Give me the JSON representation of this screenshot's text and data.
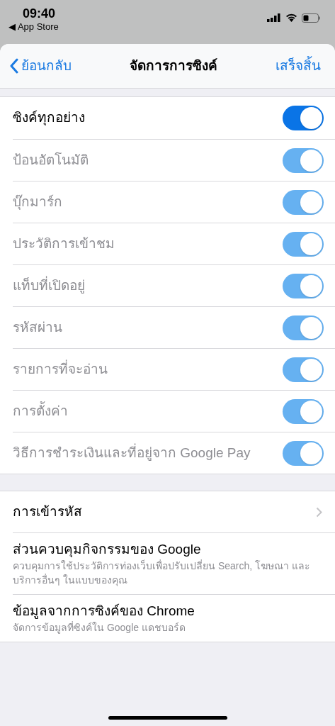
{
  "status_bar": {
    "time": "09:40",
    "back_app": "◀ App Store"
  },
  "nav": {
    "back": "ย้อนกลับ",
    "title": "จัดการการซิงค์",
    "done": "เสร็จสิ้น"
  },
  "sync_items": [
    {
      "label": "ซิงค์ทุกอย่าง",
      "on": true,
      "disabled": false
    },
    {
      "label": "ป้อนอัตโนมัติ",
      "on": true,
      "disabled": true
    },
    {
      "label": "บุ๊กมาร์ก",
      "on": true,
      "disabled": true
    },
    {
      "label": "ประวัติการเข้าชม",
      "on": true,
      "disabled": true
    },
    {
      "label": "แท็บที่เปิดอยู่",
      "on": true,
      "disabled": true
    },
    {
      "label": "รหัสผ่าน",
      "on": true,
      "disabled": true
    },
    {
      "label": "รายการที่จะอ่าน",
      "on": true,
      "disabled": true
    },
    {
      "label": "การตั้งค่า",
      "on": true,
      "disabled": true
    },
    {
      "label": "วิธีการชำระเงินและที่อยู่จาก Google Pay",
      "on": true,
      "disabled": true
    }
  ],
  "other_items": [
    {
      "kind": "chevron",
      "title": "การเข้ารหัส"
    },
    {
      "kind": "subtitle",
      "title": "ส่วนควบคุมกิจกรรมของ Google",
      "subtitle": "ควบคุมการใช้ประวัติการท่องเว็บเพื่อปรับเปลี่ยน Search, โฆษณา และบริการอื่นๆ ในแบบของคุณ"
    },
    {
      "kind": "subtitle",
      "title": "ข้อมูลจากการซิงค์ของ Chrome",
      "subtitle": "จัดการข้อมูลที่ซิงค์ใน Google แดชบอร์ด"
    }
  ]
}
